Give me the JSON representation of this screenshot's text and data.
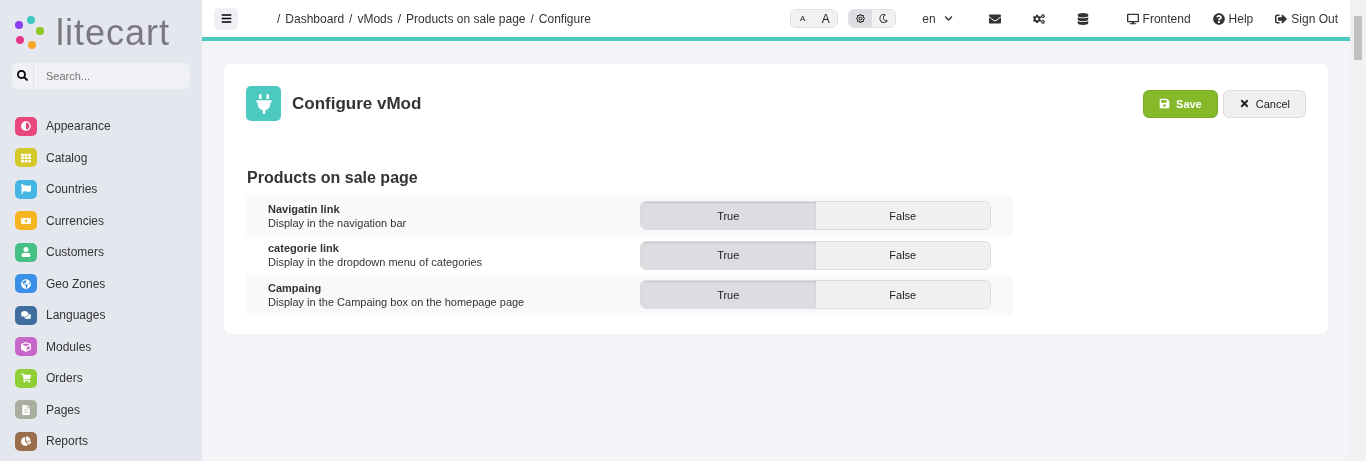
{
  "sidebar": {
    "logo": "litecart",
    "search": {
      "placeholder": "Search..."
    },
    "items": [
      {
        "label": "Appearance",
        "kind": "appearance",
        "color": "#e8467c"
      },
      {
        "label": "Catalog",
        "kind": "catalog",
        "color": "#d4c82a"
      },
      {
        "label": "Countries",
        "kind": "countries",
        "color": "#45b5e3"
      },
      {
        "label": "Currencies",
        "kind": "currencies",
        "color": "#f5b521"
      },
      {
        "label": "Customers",
        "kind": "customers",
        "color": "#47c085"
      },
      {
        "label": "Geo Zones",
        "kind": "geozones",
        "color": "#3a8fe8"
      },
      {
        "label": "Languages",
        "kind": "languages",
        "color": "#3f6d9e"
      },
      {
        "label": "Modules",
        "kind": "modules",
        "color": "#c767c9"
      },
      {
        "label": "Orders",
        "kind": "orders",
        "color": "#8fce35"
      },
      {
        "label": "Pages",
        "kind": "pages",
        "color": "#a8ad9f"
      },
      {
        "label": "Reports",
        "kind": "reports",
        "color": "#9a6e4a"
      }
    ]
  },
  "topbar": {
    "breadcrumbs": [
      {
        "separator": "/",
        "label": "Dashboard"
      },
      {
        "separator": "/",
        "label": "vMods"
      },
      {
        "separator": "/",
        "label": "Products on sale page"
      },
      {
        "separator": "/",
        "label": "Configure"
      }
    ],
    "font_sizes": [
      "A",
      "A"
    ],
    "theme": [
      {
        "kind": "light",
        "selected": true
      },
      {
        "kind": "dark",
        "selected": false
      }
    ],
    "language": "en",
    "links": [
      {
        "kind": "frontend",
        "label": "Frontend"
      },
      {
        "kind": "help",
        "label": "Help"
      },
      {
        "kind": "signout",
        "label": "Sign Out"
      }
    ]
  },
  "card": {
    "title": "Configure vMod",
    "buttons": [
      {
        "kind": "save",
        "label": "Save"
      },
      {
        "kind": "cancel",
        "label": "Cancel"
      }
    ],
    "section_title": "Products on sale page",
    "settings": [
      {
        "name": "Navigatin link",
        "description": "Display in the navigation bar",
        "options": [
          {
            "label": "True",
            "selected": true
          },
          {
            "label": "False",
            "selected": false
          }
        ]
      },
      {
        "name": "categorie link",
        "description": "Display in the dropdown menu of categories",
        "options": [
          {
            "label": "True",
            "selected": true
          },
          {
            "label": "False",
            "selected": false
          }
        ]
      },
      {
        "name": "Campaing",
        "description": "Display in the Campaing box on the homepage page",
        "options": [
          {
            "label": "True",
            "selected": true
          },
          {
            "label": "False",
            "selected": false
          }
        ]
      }
    ]
  }
}
